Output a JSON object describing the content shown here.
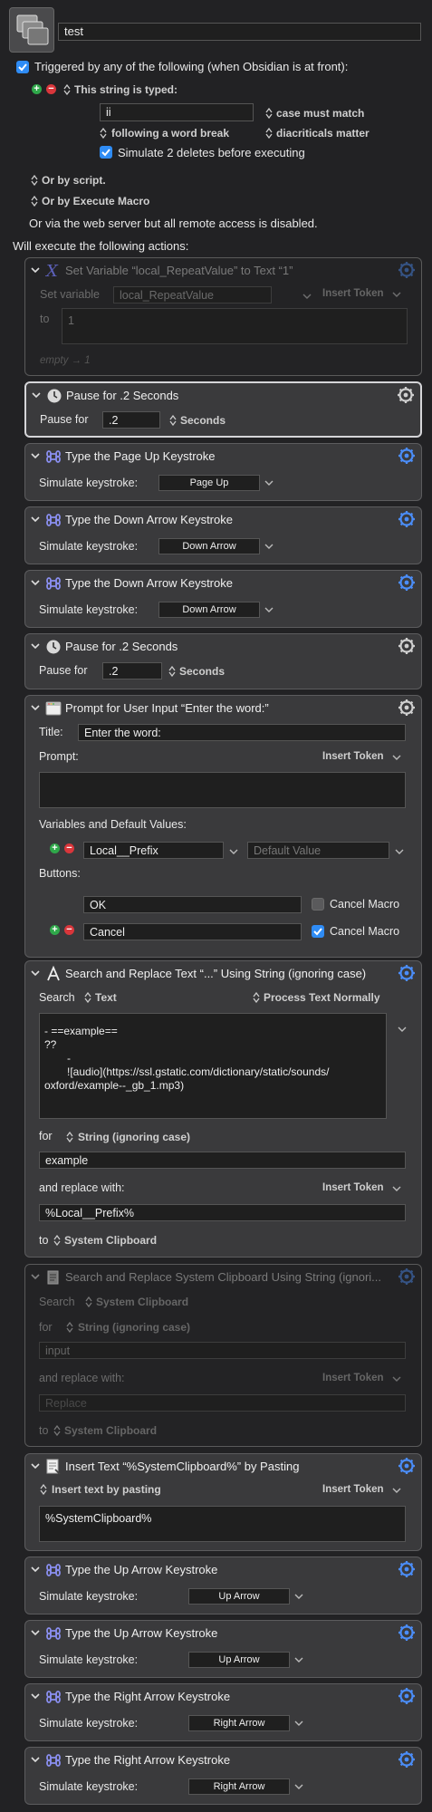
{
  "macro": {
    "name": "test",
    "trigger_header": "Triggered by any of the following (when Obsidian is at front):",
    "trigger_type": "This string is typed:",
    "typed_string": "ii",
    "case_option": "case must match",
    "word_break_option": "following a word break",
    "diacriticals_option": "diacriticals matter",
    "simulate_deletes": "Simulate 2 deletes before executing",
    "or_by_script": "Or by script.",
    "or_by_execute": "Or by Execute Macro",
    "web_server_note": "Or via the web server but all remote access is disabled.",
    "will_execute": "Will execute the following actions:"
  },
  "actions": [
    {
      "title": "Set Variable “local_RepeatValue” to Text “1”",
      "set_variable_label": "Set variable",
      "variable": "local_RepeatValue",
      "insert_token": "Insert Token",
      "to_label": "to",
      "value": "1",
      "empty_preview": "empty → 1",
      "icon": "variable-x-icon"
    },
    {
      "title": "Pause for .2 Seconds",
      "pause_label": "Pause for",
      "value": ".2",
      "unit": "Seconds",
      "icon": "pause-clock-icon"
    },
    {
      "title": "Type the Page Up Keystroke",
      "simulate_label": "Simulate keystroke:",
      "key": "Page Up",
      "icon": "command-key-icon"
    },
    {
      "title": "Type the Down Arrow Keystroke",
      "simulate_label": "Simulate keystroke:",
      "key": "Down Arrow",
      "icon": "command-key-icon"
    },
    {
      "title": "Type the Down Arrow Keystroke",
      "simulate_label": "Simulate keystroke:",
      "key": "Down Arrow",
      "icon": "command-key-icon"
    },
    {
      "title": "Pause for .2 Seconds",
      "pause_label": "Pause for",
      "value": ".2",
      "unit": "Seconds",
      "icon": "pause-clock-icon"
    },
    {
      "title": "Prompt for User Input “Enter the word:”",
      "title_label": "Title:",
      "title_value": "Enter the word:",
      "prompt_label": "Prompt:",
      "insert_token": "Insert Token",
      "vars_label": "Variables and Default Values:",
      "variable_name": "Local__Prefix",
      "default_placeholder": "Default Value",
      "buttons_label": "Buttons:",
      "button1": "OK",
      "button1_cancel": "Cancel Macro",
      "button2": "Cancel",
      "button2_cancel": "Cancel Macro",
      "icon": "window-icon"
    },
    {
      "title": "Search and Replace Text “...” Using String (ignoring case)",
      "search_label": "Search",
      "search_target": "Text",
      "process_option": "Process Text Normally",
      "text_line1": "-  ==example==",
      "text_line2": "??",
      "text_line3": "-",
      "text_line4": "![audio](https://ssl.gstatic.com/dictionary/static/sounds/",
      "text_line5": "oxford/example--_gb_1.mp3)",
      "for_label": "for",
      "mode": "String (ignoring case)",
      "for_value": "example",
      "replace_label": "and replace with:",
      "insert_token": "Insert Token",
      "replace_value": "%Local__Prefix%",
      "to_label": "to",
      "to_target": "System Clipboard",
      "icon": "text-a-icon"
    },
    {
      "title": "Search and Replace System Clipboard Using String (ignori...",
      "search_label": "Search",
      "search_target": "System Clipboard",
      "for_label": "for",
      "mode": "String (ignoring case)",
      "for_value": "input",
      "replace_label": "and replace with:",
      "insert_token": "Insert Token",
      "replace_placeholder": "Replace",
      "to_label": "to",
      "to_target": "System Clipboard",
      "icon": "clipboard-doc-icon"
    },
    {
      "title": "Insert Text “%SystemClipboard%” by Pasting",
      "mode": "Insert text by pasting",
      "insert_token": "Insert Token",
      "value": "%SystemClipboard%",
      "icon": "insert-text-icon"
    },
    {
      "title": "Type the Up Arrow Keystroke",
      "simulate_label": "Simulate keystroke:",
      "key": "Up Arrow",
      "icon": "command-key-icon"
    },
    {
      "title": "Type the Up Arrow Keystroke",
      "simulate_label": "Simulate keystroke:",
      "key": "Up Arrow",
      "icon": "command-key-icon"
    },
    {
      "title": "Type the Right Arrow Keystroke",
      "simulate_label": "Simulate keystroke:",
      "key": "Right Arrow",
      "icon": "command-key-icon"
    },
    {
      "title": "Type the Right Arrow Keystroke",
      "simulate_label": "Simulate keystroke:",
      "key": "Right Arrow",
      "icon": "command-key-icon"
    }
  ],
  "colors": {
    "background": "#222224",
    "action_bg": "#3a3a3c",
    "accent_blue": "#2f8cf5",
    "gear_blue": "#4b8df8"
  }
}
